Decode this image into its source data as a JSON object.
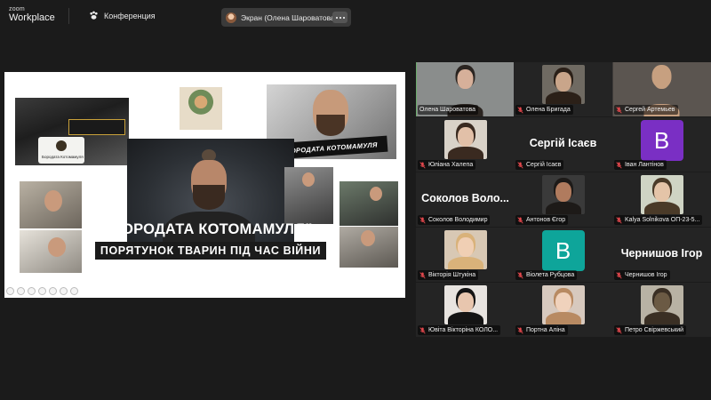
{
  "topbar": {
    "brand_small": "zoom",
    "brand_big": "Workplace",
    "app_name": "Конференция",
    "share_label": "Экран (Олена Шароватова)"
  },
  "slide": {
    "title_line1": "“БОРОДАТА КОТОМАМУЛЯ”:",
    "title_line2": "ПОРЯТУНОК ТВАРИН ПІД ЧАС ВІЙНИ",
    "banner": "БОРОДАТА КОТОМАМУЛЯ",
    "card_text": "Бородата Котомамуля"
  },
  "participants": [
    {
      "name": "Олена Шароватова",
      "muted": false,
      "kind": "video",
      "bg": "#8a8d8c",
      "face": "#d6b09a",
      "hair": "#2a2420",
      "active": true
    },
    {
      "name": "Олена Бригада",
      "muted": true,
      "kind": "photo",
      "bg": "#6f6a62",
      "face": "#c9a58a",
      "hair": "#2b2018"
    },
    {
      "name": "Сергей Артемьев",
      "muted": true,
      "kind": "video",
      "bg": "#5b5550",
      "face": "#c7a080",
      "hair": "#c7a080"
    },
    {
      "name": "Юліана Халепа",
      "muted": true,
      "kind": "photo",
      "bg": "#d9d2c8",
      "face": "#e2c0a8",
      "hair": "#3a2a20"
    },
    {
      "name": "Сергій Ісаєв",
      "muted": true,
      "kind": "text",
      "display": "Сергій Ісаєв"
    },
    {
      "name": "Іван Лантінов",
      "muted": true,
      "kind": "letter",
      "letter": "B",
      "color": "#7a2fc4"
    },
    {
      "name": "Соколов Володимир",
      "muted": true,
      "kind": "text",
      "display": "Соколов Воло..."
    },
    {
      "name": "Антонов Єгор",
      "muted": true,
      "kind": "photo",
      "bg": "#3a3a3a",
      "face": "#b07b5e",
      "hair": "#1d1a18"
    },
    {
      "name": "Kalya Solnikova ОП-23-5...",
      "muted": true,
      "kind": "photo",
      "bg": "#cfd4c4",
      "face": "#e4c4a8",
      "hair": "#4a3a28"
    },
    {
      "name": "Вікторія Штукіна",
      "muted": true,
      "kind": "photo",
      "bg": "#d8c8b4",
      "face": "#f0cfb4",
      "hair": "#d9b27a"
    },
    {
      "name": "Віолета Рубцова",
      "muted": true,
      "kind": "letter",
      "letter": "B",
      "color": "#0ea59a"
    },
    {
      "name": "Чернишов Ігор",
      "muted": true,
      "kind": "text",
      "display": "Чернишов Ігор"
    },
    {
      "name": "Ювіта Вікторіна КОЛО...",
      "muted": true,
      "kind": "photo",
      "bg": "#e8e4e0",
      "face": "#e8c6ae",
      "hair": "#141414"
    },
    {
      "name": "Портна Аліна",
      "muted": true,
      "kind": "photo",
      "bg": "#d7c9be",
      "face": "#f0d2bc",
      "hair": "#b88a62"
    },
    {
      "name": "Петро Свіржевський",
      "muted": true,
      "kind": "photo",
      "bg": "#b8b2a4",
      "face": "#6b5a44",
      "hair": "#3a2f24"
    }
  ]
}
